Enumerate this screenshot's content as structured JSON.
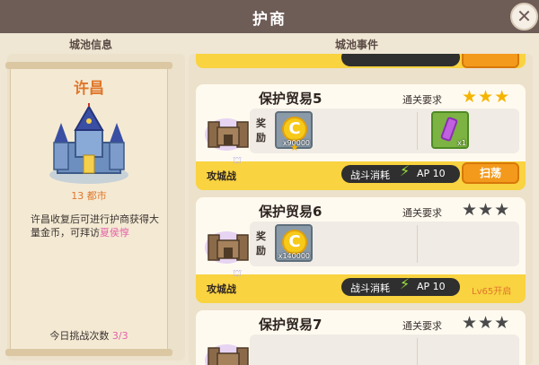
{
  "header": {
    "title": "护商",
    "close_icon": "close-icon"
  },
  "sections": {
    "left_label": "城池信息",
    "right_label": "城池事件"
  },
  "city": {
    "name": "许昌",
    "count_label": "13 都市",
    "description_prefix": "许昌收复后可进行护商获得大量金币，可拜访",
    "highlight_name": "夏侯惇",
    "challenge_label": "今日挑战次数",
    "challenge_value": "3/3"
  },
  "events": [
    {
      "title": "保护贸易5",
      "requirement_label": "通关要求",
      "stars_filled": 3,
      "stars_total": 3,
      "reward_label": "奖励",
      "coin_qty": "x90000",
      "extra_item_qty": "x1",
      "type_label": "攻城战",
      "cost_label": "战斗消耗",
      "cost_value": "AP 10",
      "action_label": "扫荡"
    },
    {
      "title": "保护贸易6",
      "requirement_label": "通关要求",
      "stars_filled": 0,
      "stars_total": 3,
      "reward_label": "奖励",
      "coin_qty": "x140000",
      "type_label": "攻城战",
      "cost_label": "战斗消耗",
      "cost_value": "AP 10",
      "lock_label": "Lv65开启"
    },
    {
      "title": "保护贸易7",
      "requirement_label": "通关要求",
      "stars_filled": 0,
      "stars_total": 3
    }
  ],
  "colors": {
    "accent_orange": "#e0762a",
    "highlight_pink": "#e55fa8",
    "card_yellow": "#f9d340",
    "button_orange": "#f39a1c"
  }
}
